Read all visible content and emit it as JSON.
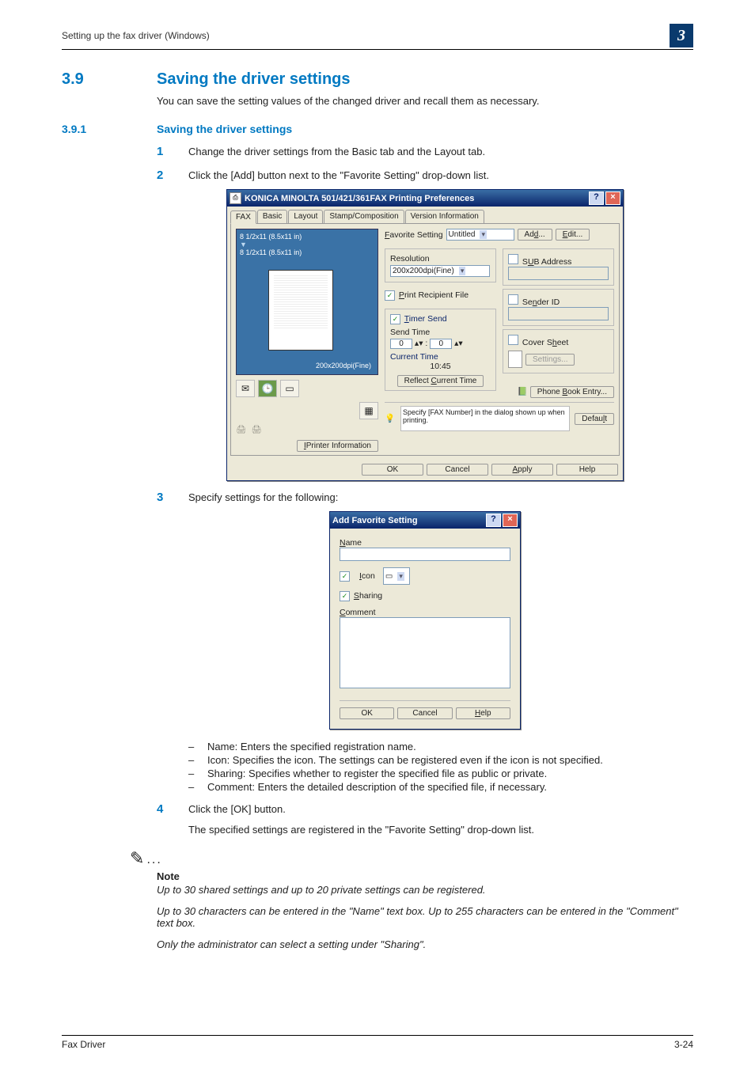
{
  "header": {
    "breadcrumb": "Setting up the fax driver (Windows)",
    "chapter": "3"
  },
  "section": {
    "num": "3.9",
    "title": "Saving the driver settings",
    "intro": "You can save the setting values of the changed driver and recall them as necessary."
  },
  "subsection": {
    "num": "3.9.1",
    "title": "Saving the driver settings"
  },
  "steps": {
    "s1_num": "1",
    "s1": "Change the driver settings from the Basic tab and the Layout tab.",
    "s2_num": "2",
    "s2": "Click the [Add] button next to the \"Favorite Setting\" drop-down list.",
    "s3_num": "3",
    "s3": "Specify settings for the following:",
    "s4_num": "4",
    "s4": "Click the [OK] button.",
    "s4_result": "The specified settings are registered in the \"Favorite Setting\" drop-down list."
  },
  "dlg1": {
    "title": "KONICA MINOLTA 501/421/361FAX Printing Preferences",
    "help_btn": "?",
    "close_btn": "×",
    "tabs": {
      "fax": "FAX",
      "basic": "Basic",
      "layout": "Layout",
      "stamp": "Stamp/Composition",
      "version": "Version Information"
    },
    "preview": {
      "line1": "8 1/2x11 (8.5x11 in)",
      "line2": "8 1/2x11 (8.5x11 in)",
      "dpi": "200x200dpi(Fine)"
    },
    "printer_info": "Printer Information",
    "fav_label": "Favorite Setting",
    "fav_value": "Untitled",
    "add": "Add...",
    "edit": "Edit...",
    "resolution_label": "Resolution",
    "resolution_value": "200x200dpi(Fine)",
    "print_recipient": "Print Recipient File",
    "timer_send": "Timer Send",
    "send_time": "Send Time",
    "hour": "0",
    "minute": "0",
    "current_time_label": "Current Time",
    "current_time": "10:45",
    "reflect_btn": "Reflect Current Time",
    "sub_address": "SUB Address",
    "sender_id": "Sender ID",
    "cover_sheet": "Cover Sheet",
    "settings_btn": "Settings...",
    "phone_book": "Phone Book Entry...",
    "hint": "Specify [FAX Number] in the dialog shown up when printing.",
    "default_btn": "Default",
    "ok": "OK",
    "cancel": "Cancel",
    "apply": "Apply",
    "help": "Help"
  },
  "dlg2": {
    "title": "Add Favorite Setting",
    "help_btn": "?",
    "close_btn": "×",
    "name_label": "Name",
    "icon_label": "Icon",
    "sharing_label": "Sharing",
    "comment_label": "Comment",
    "ok": "OK",
    "cancel": "Cancel",
    "help": "Help"
  },
  "bullets": {
    "b1": "Name: Enters the specified registration name.",
    "b2": "Icon: Specifies the icon. The settings can be registered even if the icon is not specified.",
    "b3": "Sharing: Specifies whether to register the specified file as public or private.",
    "b4": "Comment: Enters the detailed description of the specified file, if necessary."
  },
  "note": {
    "label": "Note",
    "n1": "Up to 30 shared settings and up to 20 private settings can be registered.",
    "n2": "Up to 30 characters can be entered in the \"Name\" text box. Up to 255 characters can be entered in the \"Comment\" text box.",
    "n3": "Only the administrator can select a setting under \"Sharing\"."
  },
  "footer": {
    "left": "Fax Driver",
    "right": "3-24"
  }
}
